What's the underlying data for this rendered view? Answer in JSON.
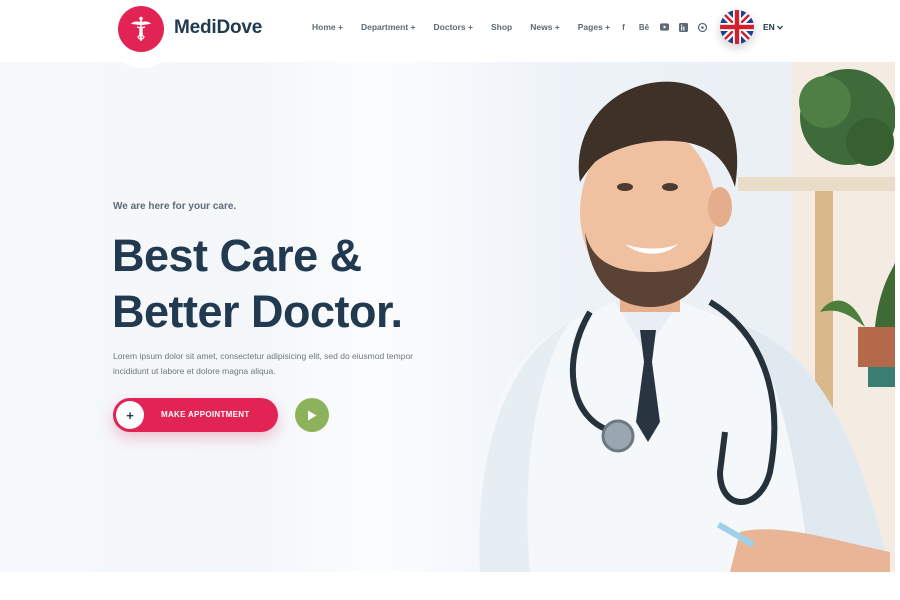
{
  "brand": {
    "name": "MediDove"
  },
  "nav": {
    "items": [
      {
        "label": "Home +"
      },
      {
        "label": "Department +"
      },
      {
        "label": "Doctors +"
      },
      {
        "label": "Shop"
      },
      {
        "label": "News +"
      },
      {
        "label": "Pages +"
      }
    ]
  },
  "social": {
    "facebook": "f",
    "behance": "Bē",
    "youtube": "youtube-icon",
    "linkedin": "linkedin-icon",
    "pinterest": "pinterest-icon"
  },
  "language": {
    "label": "EN"
  },
  "hero": {
    "tagline": "We are here for your care.",
    "title_line1": "Best Care &",
    "title_line2": "Better Doctor.",
    "description": "Lorem ipsum dolor sit amet, consectetur adipisicing elit, sed do eiusmod tempor incididunt ut labore et dolore magna aliqua.",
    "cta_label": "MAKE APPOINTMENT",
    "cta_icon": "+"
  },
  "colors": {
    "primary": "#e12454",
    "heading": "#223a50",
    "play": "#8cb35b"
  }
}
